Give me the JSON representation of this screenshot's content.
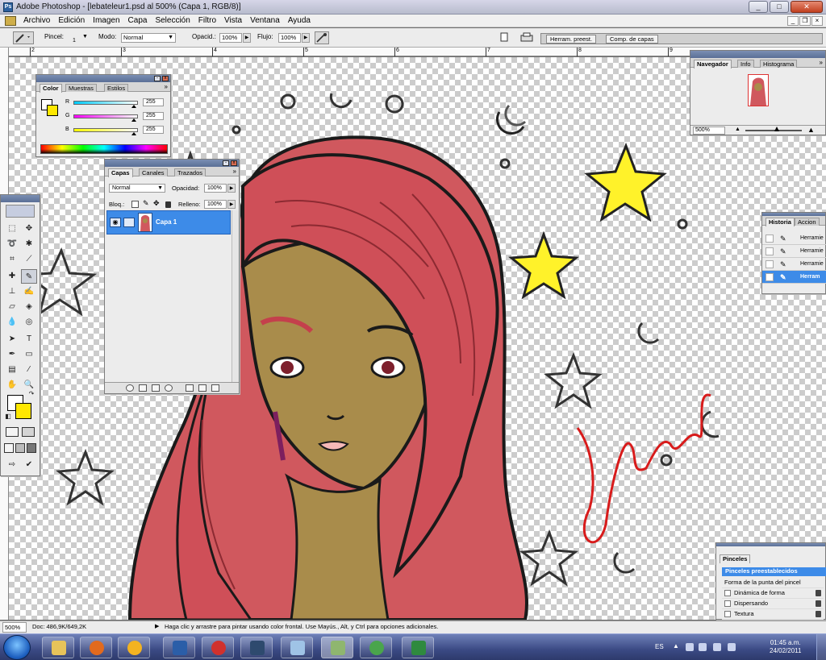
{
  "window": {
    "title": "Adobe Photoshop - [lebateleur1.psd al 500% (Capa 1, RGB/8)]",
    "controls": [
      "_",
      "□",
      "✕"
    ],
    "doc_controls": [
      "_",
      "❐",
      "×"
    ]
  },
  "menu": [
    "Archivo",
    "Edición",
    "Imagen",
    "Capa",
    "Selección",
    "Filtro",
    "Vista",
    "Ventana",
    "Ayuda"
  ],
  "options": {
    "brush_label": "Pincel:",
    "brush_size": "1",
    "mode_label": "Modo:",
    "mode_value": "Normal",
    "opacity_label": "Opacid.:",
    "opacity_value": "100%",
    "flow_label": "Flujo:",
    "flow_value": "100%",
    "well_tabs": [
      "Herram. preest.",
      "Comp. de capas"
    ]
  },
  "ruler_numbers": [
    "2",
    "3",
    "4",
    "5",
    "6",
    "7",
    "8",
    "9"
  ],
  "color_palette": {
    "tabs": [
      "Color",
      "Muestras",
      "Estilos"
    ],
    "channels": [
      {
        "label": "R",
        "value": "255",
        "color": "#00ccff"
      },
      {
        "label": "G",
        "value": "255",
        "color": "#ff00ff"
      },
      {
        "label": "B",
        "value": "255",
        "color": "#ffff00"
      }
    ],
    "foreground": "#ffffff",
    "background": "#ffe800"
  },
  "layers_palette": {
    "tabs": [
      "Capas",
      "Canales",
      "Trazados"
    ],
    "blend_mode": "Normal",
    "opacity_label": "Opacidad:",
    "opacity_value": "100%",
    "lock_label": "Bloq.:",
    "fill_label": "Relleno:",
    "fill_value": "100%",
    "layers": [
      {
        "name": "Capa 1",
        "visible": true,
        "selected": true
      }
    ]
  },
  "navigator": {
    "tabs": [
      "Navegador",
      "Info",
      "Histograma"
    ],
    "zoom": "500%"
  },
  "history": {
    "tabs": [
      "Historia",
      "Accion"
    ],
    "items": [
      "Herramie",
      "Herramie",
      "Herramie",
      "Herram"
    ]
  },
  "brushes": {
    "title": "Pinceles",
    "header": "Pinceles preestablecidos",
    "items": [
      {
        "label": "Forma de la punta del pincel",
        "checkbox": false
      },
      {
        "label": "Dinámica de forma",
        "checkbox": true
      },
      {
        "label": "Dispersando",
        "checkbox": true
      },
      {
        "label": "Textura",
        "checkbox": true
      }
    ]
  },
  "status": {
    "zoom": "500%",
    "doc": "Doc: 486,9K/649,2K",
    "hint": "Haga clic y arrastre para pintar usando color frontal. Use Mayús., Alt, y Ctrl para opciones adicionales."
  },
  "artwork": {
    "signature": "Julianes",
    "hair_color": "#d0585e",
    "skin_color": "#a98c4b",
    "star_color": "#fff22a"
  },
  "taskbar": {
    "language": "ES",
    "time": "01:45 a.m.",
    "date": "24/02/2011"
  }
}
